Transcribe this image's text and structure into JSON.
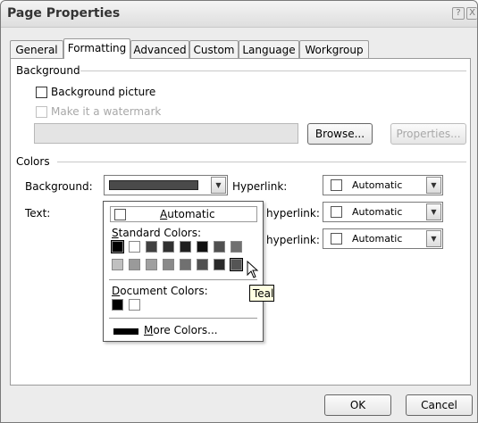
{
  "window": {
    "title": "Page Properties",
    "help_glyph": "?",
    "close_glyph": "X"
  },
  "tabs": [
    {
      "label": "General"
    },
    {
      "label": "Formatting"
    },
    {
      "label": "Advanced"
    },
    {
      "label": "Custom"
    },
    {
      "label": "Language"
    },
    {
      "label": "Workgroup"
    }
  ],
  "background_group": {
    "title": "Background",
    "background_picture": "Background picture",
    "watermark": "Make it a watermark",
    "browse": "Browse...",
    "properties": "Properties..."
  },
  "colors_group": {
    "title": "Colors",
    "background_label": "Background:",
    "text_label": "Text:",
    "hyperlink_label": "Hyperlink:",
    "visited_label": "hyperlink:",
    "active_label": "hyperlink:",
    "automatic": "Automatic"
  },
  "popup": {
    "automatic": "Automatic",
    "standard_label": "Standard Colors:",
    "document_label": "Document Colors:",
    "more_colors": "More Colors...",
    "standard_row1": [
      "#000000",
      "#ffffff",
      "#404040",
      "#303030",
      "#202020",
      "#101010",
      "#505050",
      "#707070"
    ],
    "standard_row2": [
      "#c0c0c0",
      "#9a9a9a",
      "#a0a0a0",
      "#8a8a8a",
      "#707070",
      "#505050",
      "#2a2a2a",
      "#555555"
    ],
    "document_colors": [
      "#000000",
      "#ffffff"
    ],
    "tooltip": "Teal"
  },
  "footer": {
    "ok": "OK",
    "cancel": "Cancel"
  }
}
